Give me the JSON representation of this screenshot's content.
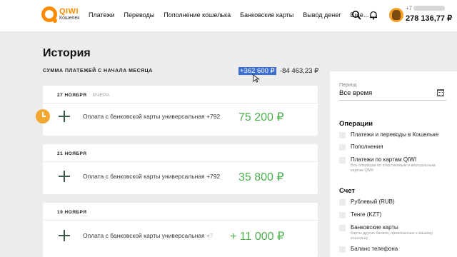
{
  "header": {
    "logo_name": "QIWI",
    "logo_sub": "Кошелек",
    "nav": [
      "Платежи",
      "Переводы",
      "Пополнение кошелька",
      "Банковские карты",
      "Вывод денег",
      "Еще..."
    ],
    "phone_prefix": "+7",
    "balance": "278 136,77 ₽",
    "icons": [
      "search-icon",
      "bell-icon"
    ]
  },
  "history": {
    "title": "История",
    "sum_label": "СУММА ПЛАТЕЖЕЙ С НАЧАЛА МЕСЯЦА",
    "sum_plus": "+362 600 ₽",
    "sum_minus": "-84 463,23 ₽"
  },
  "groups": [
    {
      "date": "27 НОЯБРЯ",
      "sub": "ВЧЕРА",
      "desc": "Оплата с банковской карты универсальная +792",
      "amount": "75 200 ₽"
    },
    {
      "date": "21 НОЯБРЯ",
      "sub": "",
      "desc": "Оплата с банковской карты универсальная +792",
      "amount": "35 800 ₽"
    },
    {
      "date": "19 НОЯБРЯ",
      "sub": "",
      "desc": "Оплата с банковской карты универсальная +7",
      "amount": "+ 11 000 ₽"
    }
  ],
  "filter": {
    "period_label": "Период",
    "period_value": "Все время",
    "operations_title": "Операции",
    "operations": [
      {
        "label": "Платежи и переводы в Кошельке",
        "hint": ""
      },
      {
        "label": "Пополнения",
        "hint": ""
      },
      {
        "label": "Платежи по картам QIWI",
        "hint": "Все операции по пластиковым и виртуальным картам QIWI"
      }
    ],
    "account_title": "Счет",
    "accounts": [
      {
        "label": "Рублевый (RUB)",
        "hint": ""
      },
      {
        "label": "Тенге (KZT)",
        "hint": ""
      },
      {
        "label": "Банковские карты",
        "hint": "Карты других банков, привязанные к вашему кошельку"
      },
      {
        "label": "Баланс телефона",
        "hint": ""
      }
    ]
  },
  "colors": {
    "brand": "#ff8c00",
    "income": "#4caf50",
    "selection": "#3d6fd1"
  }
}
